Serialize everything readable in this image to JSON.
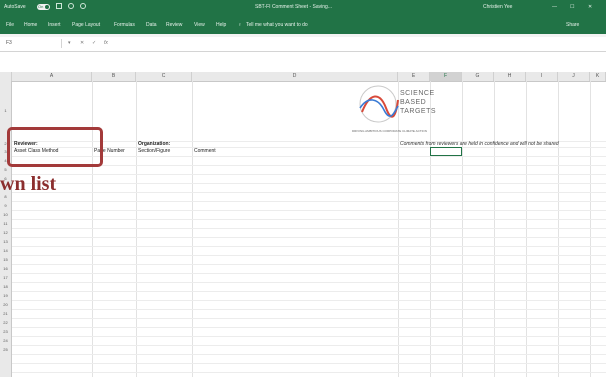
{
  "window": {
    "autosave_label": "AutoSave",
    "autosave_state": "On",
    "title": "SBT-FI Comment Sheet - Saving...",
    "user": "Christien Yee"
  },
  "ribbon": {
    "tabs": [
      "File",
      "Home",
      "Insert",
      "Page Layout",
      "Formulas",
      "Data",
      "Review",
      "View",
      "Help"
    ],
    "tell_me": "Tell me what you want to do",
    "share": "Share"
  },
  "formula_bar": {
    "name_box": "F3",
    "fx": "fx"
  },
  "columns": [
    "A",
    "B",
    "C",
    "D",
    "E",
    "F",
    "G",
    "H",
    "I",
    "J",
    "K"
  ],
  "selected_column": "F",
  "rows": [
    "1",
    "2",
    "3",
    "4",
    "5",
    "6",
    "7",
    "8",
    "9",
    "10",
    "11",
    "12",
    "13",
    "14",
    "15",
    "16",
    "17",
    "18",
    "19",
    "20",
    "21",
    "22",
    "23",
    "24",
    "25"
  ],
  "cells": {
    "reviewer": "Reviewer:",
    "organization": "Organization:",
    "asset_class": "Asset Class Method",
    "page_number": "Page Number",
    "section_figure": "Section/Figure",
    "comment": "Comment",
    "confidential": "Comments from reviewers are held in confidence and will not be shared"
  },
  "logo": {
    "line1": "SCIENCE",
    "line2": "BASED",
    "line3": "TARGETS",
    "tagline": "DRIVING AMBITIOUS CORPORATE CLIMATE ACTION"
  },
  "annotation": {
    "text": "wn list",
    "color": "#a33a3a"
  },
  "colors": {
    "excel_green": "#217346",
    "callout_red": "#a33a3a"
  }
}
